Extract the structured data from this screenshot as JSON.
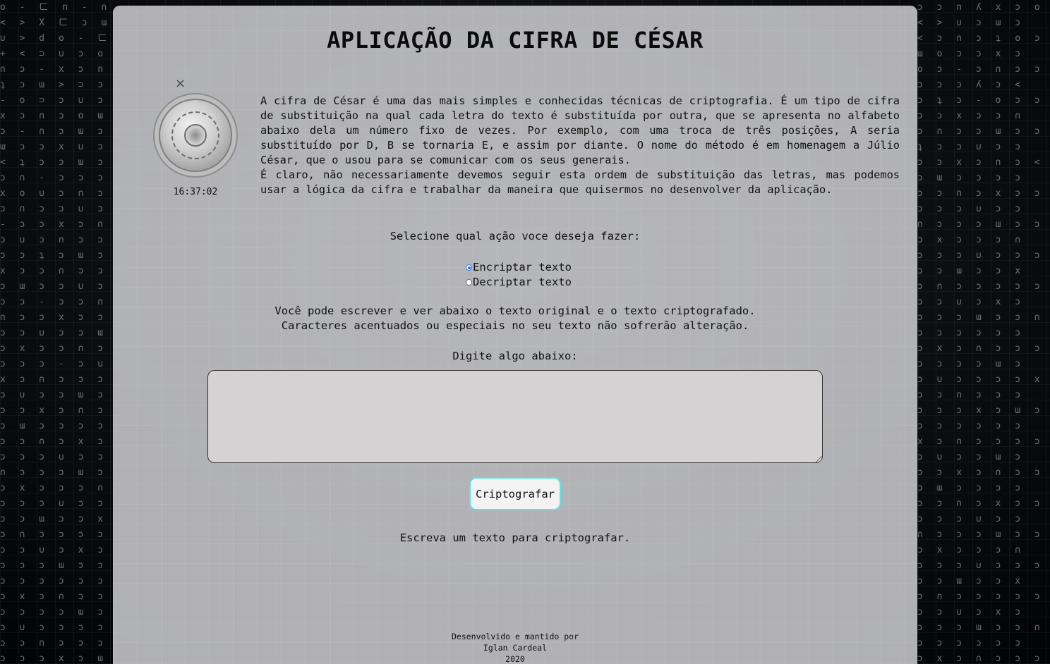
{
  "page": {
    "title": "APLICAÇÃO DA CIFRA DE CÉSAR",
    "clock": "16:37:02",
    "close_symbol": "×"
  },
  "description": {
    "paragraph1": "A cifra de César é uma das mais simples e conhecidas técnicas de criptografia. É um tipo de cifra de substituição na qual cada letra do texto é substituída por outra, que se apresenta no alfabeto abaixo dela um número fixo de vezes. Por exemplo, com uma troca de três posições, A seria substituído por D, B se tornaria E, e assim por diante. O nome do método é em homenagem a Júlio César, que o usou para se comunicar com os seus generais.",
    "paragraph2": "É claro, não necessariamente devemos seguir esta ordem de substituição das letras, mas podemos usar a lógica da cifra e trabalhar da maneira que quisermos no desenvolver da aplicação."
  },
  "action": {
    "prompt": "Selecione qual ação voce deseja fazer:",
    "options": [
      {
        "label": "Encriptar texto",
        "checked": true
      },
      {
        "label": "Decriptar texto",
        "checked": false
      }
    ]
  },
  "info": {
    "line1": "Você pode escrever e ver abaixo o texto original e o texto criptografado.",
    "line2": "Caracteres acentuados ou especiais no seu texto não sofrerão alteração."
  },
  "input": {
    "label": "Digite algo abaixo:",
    "value": "",
    "placeholder": ""
  },
  "submit": {
    "label": "Criptografar"
  },
  "result": {
    "text": "Escreva um texto para criptografar."
  },
  "footer": {
    "line1": "Desenvolvido e mantido por",
    "line2": "Iglan Cardeal",
    "line3": "2020"
  },
  "colors": {
    "accent_border": "#5fe3e0",
    "radio_selected": "#1a73e8",
    "background": "#050607"
  }
}
